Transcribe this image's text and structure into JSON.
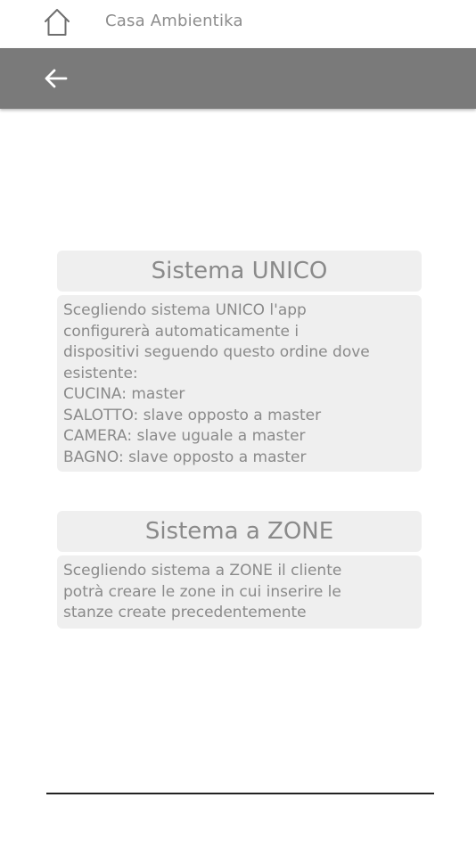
{
  "header": {
    "home_icon": "home-icon",
    "title": "Casa Ambientika"
  },
  "navbar": {
    "back_icon": "arrow-left-icon",
    "background_color": "#7a7a7a"
  },
  "options": {
    "unico": {
      "title": "Sistema UNICO",
      "description_lines": [
        "Scegliendo sistema UNICO l'app",
        "configurerà automaticamente i",
        "dispositivi seguendo questo ordine dove",
        "esistente:",
        "CUCINA: master",
        "SALOTTO: slave opposto a master",
        "CAMERA: slave uguale a master",
        "BAGNO: slave opposto a master"
      ]
    },
    "zone": {
      "title": "Sistema a ZONE",
      "description_lines": [
        "Scegliendo sistema a ZONE il cliente",
        "potrà creare le zone in cui inserire le",
        "stanze create precedentemente"
      ]
    }
  }
}
